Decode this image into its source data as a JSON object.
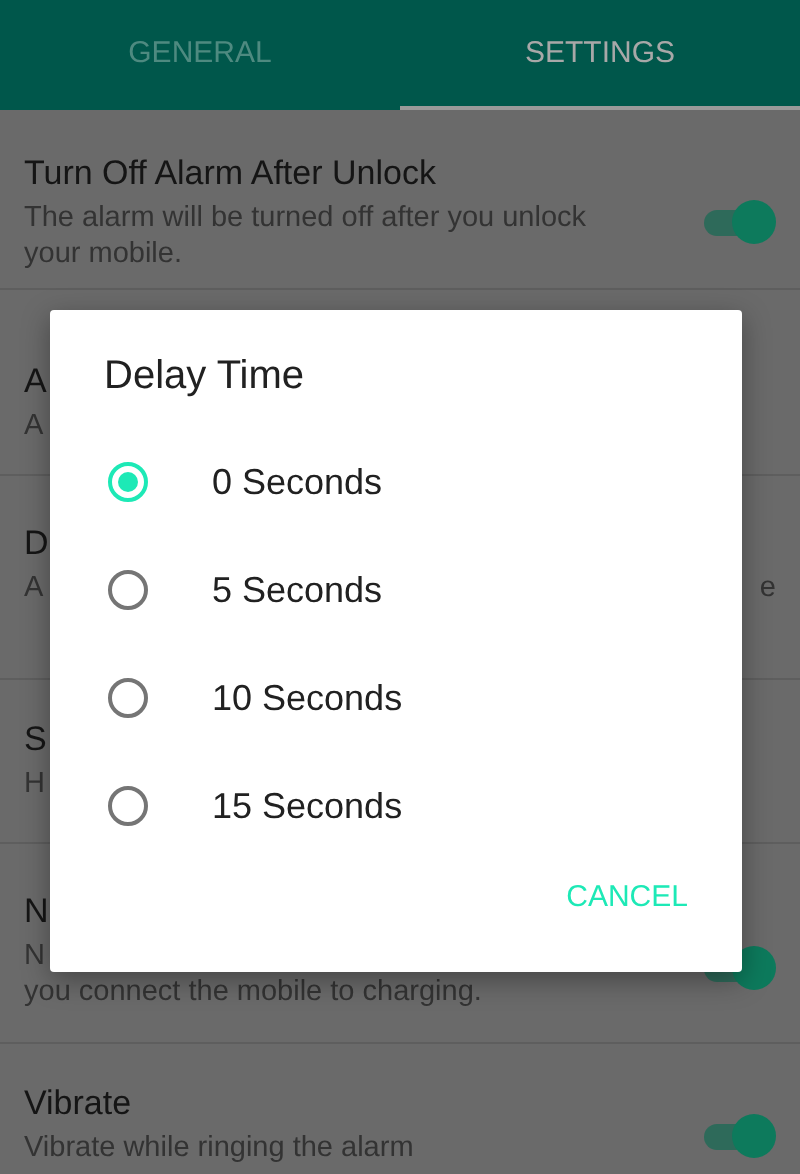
{
  "tabs": [
    {
      "label": "GENERAL",
      "selected": false
    },
    {
      "label": "SETTINGS",
      "selected": true
    }
  ],
  "settings": [
    {
      "kind": "switch",
      "on": true,
      "title": "Turn Off Alarm After Unlock",
      "subtitle_lines": [
        {
          "left": "The alarm will be turned off after you unlock your mobile."
        }
      ]
    },
    {
      "kind": "plain",
      "title": "A",
      "subtitle_lines": [
        {
          "left": "A"
        }
      ]
    },
    {
      "kind": "plain",
      "title": "D",
      "subtitle_lines": [
        {
          "left": "A",
          "right": "e"
        }
      ]
    },
    {
      "kind": "plain",
      "title": "S",
      "subtitle_lines": [
        {
          "left": "H"
        }
      ]
    },
    {
      "kind": "switch",
      "on": true,
      "title": "N",
      "subtitle_lines": [
        {
          "left": "N"
        },
        {
          "left": "you connect the mobile to charging."
        }
      ]
    },
    {
      "kind": "switch",
      "on": true,
      "title": "Vibrate",
      "subtitle_lines": [
        {
          "left": "Vibrate while ringing the alarm"
        }
      ]
    }
  ],
  "dialog": {
    "title": "Delay Time",
    "options": [
      {
        "label": "0 Seconds",
        "selected": true
      },
      {
        "label": "5 Seconds",
        "selected": false
      },
      {
        "label": "10 Seconds",
        "selected": false
      },
      {
        "label": "15 Seconds",
        "selected": false
      }
    ],
    "cancel": "CANCEL"
  }
}
